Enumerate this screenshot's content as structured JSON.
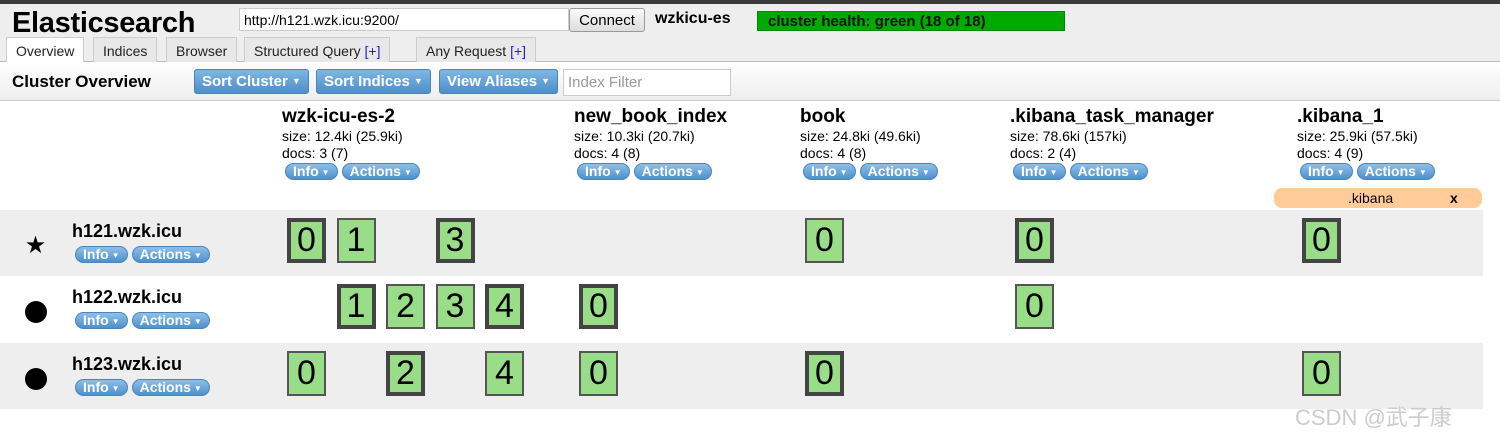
{
  "header": {
    "title": "Elasticsearch",
    "url": "http://h121.wzk.icu:9200/",
    "connect_label": "Connect",
    "cluster_name": "wzkicu-es",
    "health": "cluster health: green (18 of 18)",
    "health_color": "#00aa00"
  },
  "tabs": [
    {
      "label": "Overview",
      "plus": ""
    },
    {
      "label": "Indices",
      "plus": ""
    },
    {
      "label": "Browser",
      "plus": ""
    },
    {
      "label": "Structured Query",
      "plus": "[+]"
    },
    {
      "label": "Any Request",
      "plus": "[+]"
    }
  ],
  "toolbar": {
    "title": "Cluster Overview",
    "sort_cluster": "Sort Cluster",
    "sort_indices": "Sort Indices",
    "view_aliases": "View Aliases",
    "filter_placeholder": "Index Filter"
  },
  "buttons": {
    "info": "Info",
    "actions": "Actions"
  },
  "indices": [
    {
      "name": "wzk-icu-es-2",
      "size": "size: 12.4ki (25.9ki)",
      "docs": "docs: 3 (7)"
    },
    {
      "name": "new_book_index",
      "size": "size: 10.3ki (20.7ki)",
      "docs": "docs: 4 (8)"
    },
    {
      "name": "book",
      "size": "size: 24.8ki (49.6ki)",
      "docs": "docs: 4 (8)"
    },
    {
      "name": ".kibana_task_manager",
      "size": "size: 78.6ki (157ki)",
      "docs": "docs: 2 (4)"
    },
    {
      "name": ".kibana_1",
      "size": "size: 25.9ki (57.5ki)",
      "docs": "docs: 4 (9)"
    }
  ],
  "alias": {
    "name": ".kibana",
    "close": "x"
  },
  "nodes": [
    {
      "name": "h121.wzk.icu",
      "master": true,
      "shards": [
        [
          {
            "n": 0,
            "p": true
          },
          {
            "n": 1,
            "p": false
          },
          {
            "n": 3,
            "p": true
          }
        ],
        [],
        [
          {
            "n": 0,
            "p": false
          }
        ],
        [
          {
            "n": 0,
            "p": true
          }
        ],
        [
          {
            "n": 0,
            "p": true
          }
        ]
      ]
    },
    {
      "name": "h122.wzk.icu",
      "master": false,
      "shards": [
        [
          {
            "n": 1,
            "p": true
          },
          {
            "n": 2,
            "p": false
          },
          {
            "n": 3,
            "p": false
          },
          {
            "n": 4,
            "p": true
          }
        ],
        [
          {
            "n": 0,
            "p": true
          }
        ],
        [],
        [
          {
            "n": 0,
            "p": false
          }
        ],
        []
      ]
    },
    {
      "name": "h123.wzk.icu",
      "master": false,
      "shards": [
        [
          {
            "n": 0,
            "p": false
          },
          {
            "n": 2,
            "p": true
          },
          {
            "n": 4,
            "p": false
          }
        ],
        [
          {
            "n": 0,
            "p": false
          }
        ],
        [
          {
            "n": 0,
            "p": true
          }
        ],
        [],
        [
          {
            "n": 0,
            "p": false
          }
        ]
      ]
    }
  ],
  "watermark": "CSDN @武子康"
}
